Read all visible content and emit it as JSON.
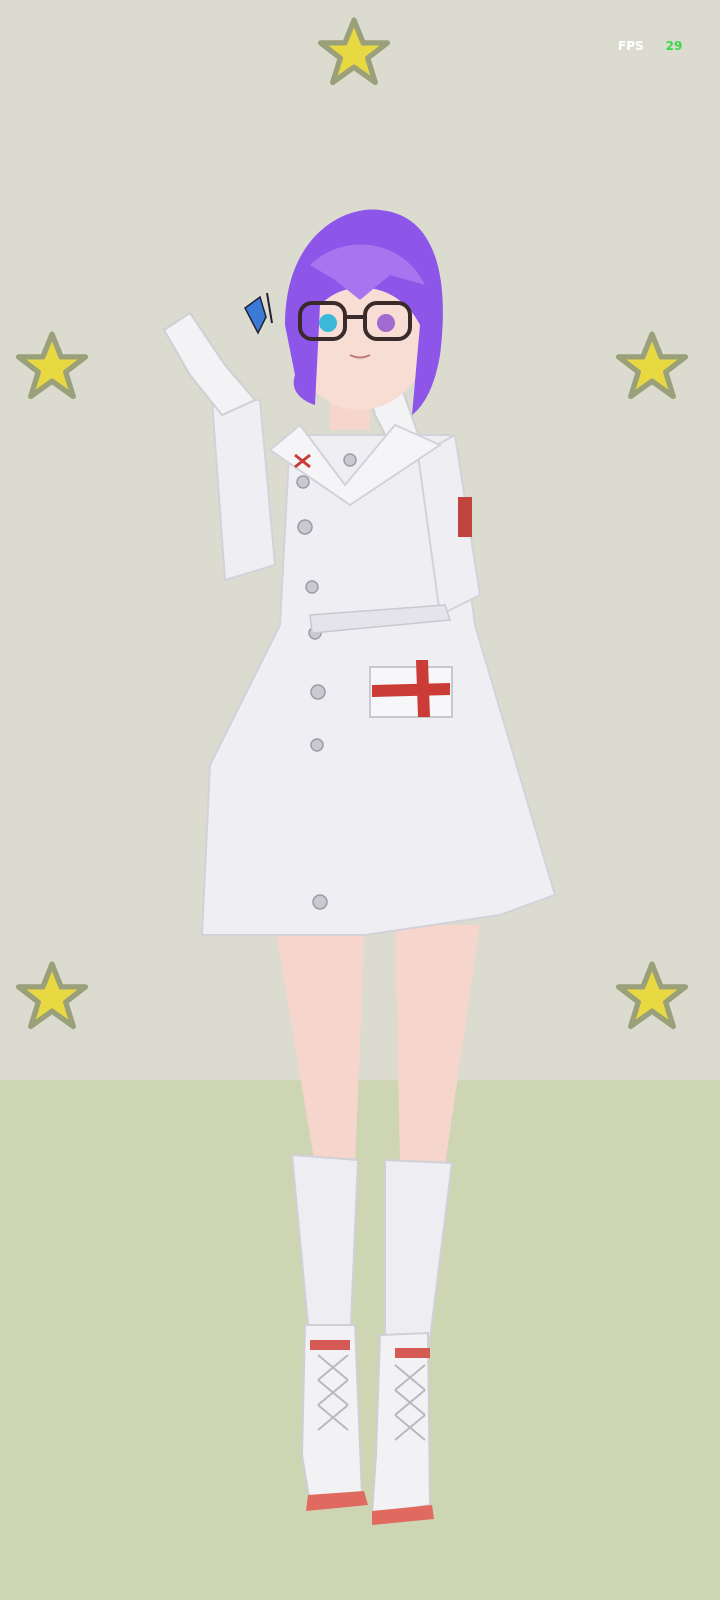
{
  "hud": {
    "fps_label": "FPS",
    "fps_value": "29"
  },
  "scene": {
    "wall_color": "#dcdbcf",
    "floor_color": "#cdd5b3",
    "star_color": "#e8d842",
    "star_count": 5,
    "character_description_icon": "nurse-character"
  }
}
